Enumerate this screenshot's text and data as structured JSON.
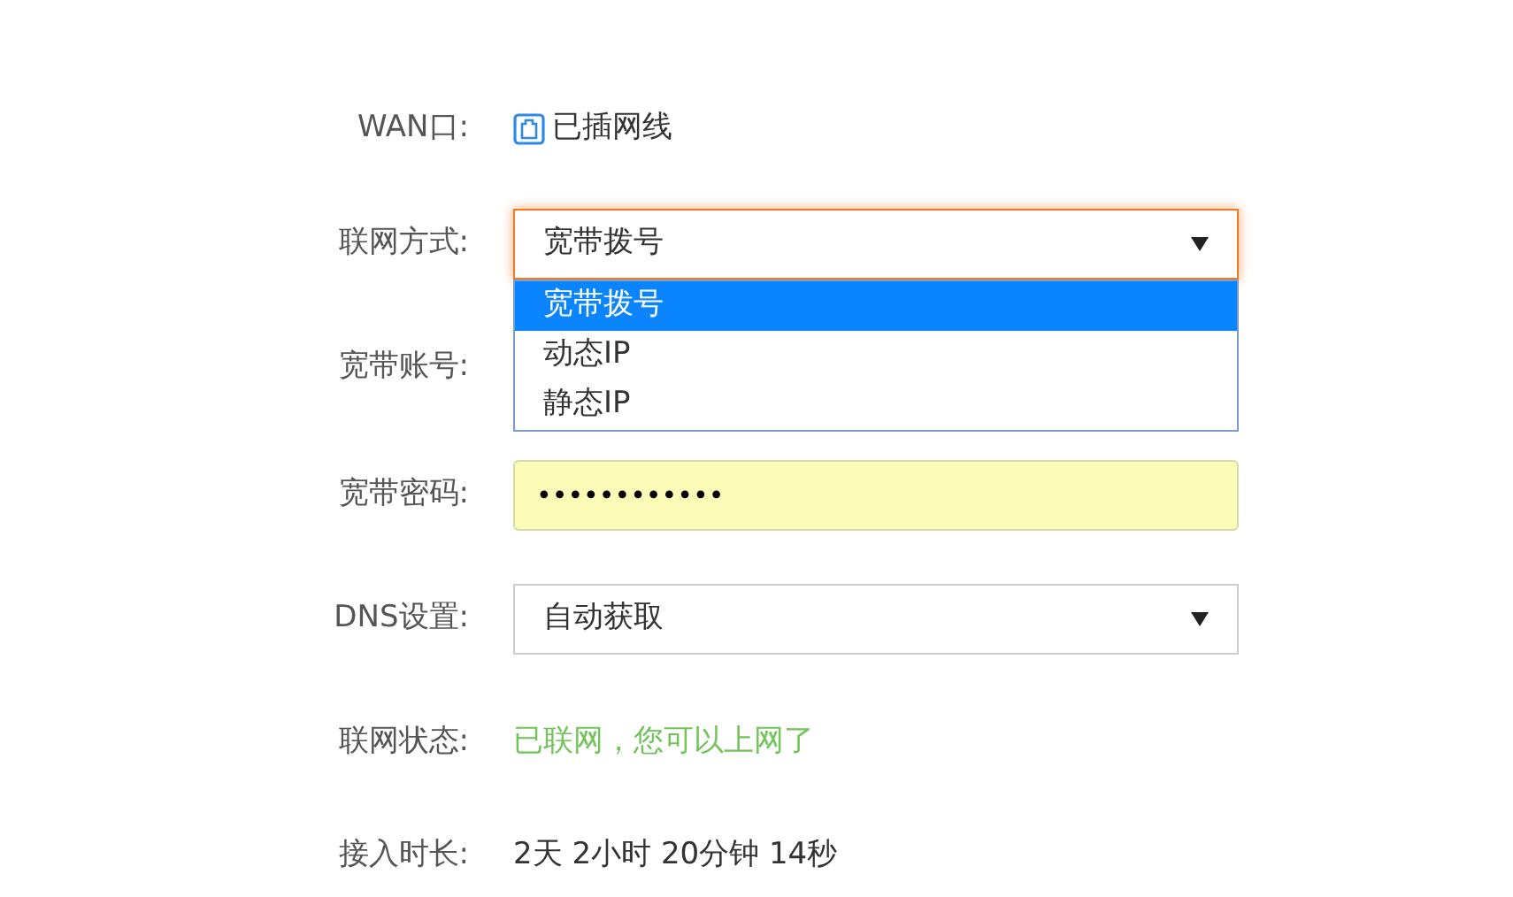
{
  "wan": {
    "label": "WAN口:",
    "status": "已插网线"
  },
  "method": {
    "label": "联网方式:",
    "value": "宽带拨号",
    "expanded": true,
    "options": [
      {
        "label": "宽带拨号",
        "selected": true
      },
      {
        "label": "动态IP",
        "selected": false
      },
      {
        "label": "静态IP",
        "selected": false
      }
    ]
  },
  "account": {
    "label": "宽带账号:"
  },
  "password": {
    "label": "宽带密码:",
    "value": "••••••••••••"
  },
  "dns": {
    "label": "DNS设置:",
    "value": "自动获取"
  },
  "net_status": {
    "label": "联网状态:",
    "value": "已联网，您可以上网了"
  },
  "uptime": {
    "label": "接入时长:",
    "value": "2天 2小时 20分钟 14秒"
  }
}
